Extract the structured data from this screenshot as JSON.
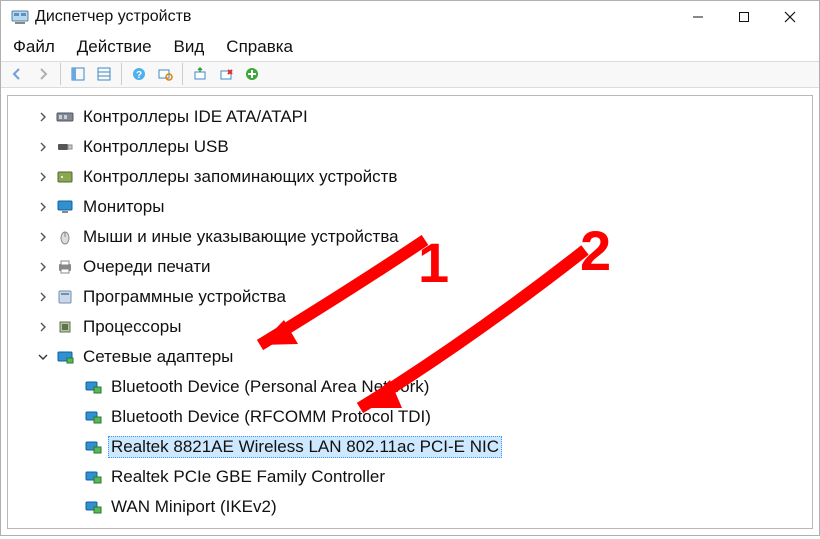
{
  "window": {
    "title": "Диспетчер устройств"
  },
  "menu": {
    "file": "Файл",
    "action": "Действие",
    "view": "Вид",
    "help": "Справка"
  },
  "toolbar": {
    "back": "back",
    "forward": "forward",
    "show_hidden": "show-hidden",
    "properties": "properties",
    "help": "help",
    "scan": "scan",
    "refresh": "refresh",
    "uninstall": "uninstall",
    "add": "add"
  },
  "tree": {
    "categories": [
      {
        "label": "Контроллеры IDE ATA/ATAPI",
        "icon": "ide",
        "expanded": false
      },
      {
        "label": "Контроллеры USB",
        "icon": "usb",
        "expanded": false
      },
      {
        "label": "Контроллеры запоминающих устройств",
        "icon": "storage",
        "expanded": false
      },
      {
        "label": "Мониторы",
        "icon": "monitor",
        "expanded": false
      },
      {
        "label": "Мыши и иные указывающие устройства",
        "icon": "mouse",
        "expanded": false
      },
      {
        "label": "Очереди печати",
        "icon": "printer",
        "expanded": false
      },
      {
        "label": "Программные устройства",
        "icon": "software",
        "expanded": false
      },
      {
        "label": "Процессоры",
        "icon": "cpu",
        "expanded": false
      },
      {
        "label": "Сетевые адаптеры",
        "icon": "network",
        "expanded": true,
        "children": [
          {
            "label": "Bluetooth Device (Personal Area Network)",
            "icon": "netadapter",
            "selected": false
          },
          {
            "label": "Bluetooth Device (RFCOMM Protocol TDI)",
            "icon": "netadapter",
            "selected": false
          },
          {
            "label": "Realtek 8821AE Wireless LAN 802.11ac PCI-E NIC",
            "icon": "netadapter",
            "selected": true
          },
          {
            "label": "Realtek PCIe GBE Family Controller",
            "icon": "netadapter",
            "selected": false
          },
          {
            "label": "WAN Miniport (IKEv2)",
            "icon": "netadapter",
            "selected": false
          }
        ]
      }
    ]
  },
  "annotations": {
    "num1": "1",
    "num2": "2"
  }
}
